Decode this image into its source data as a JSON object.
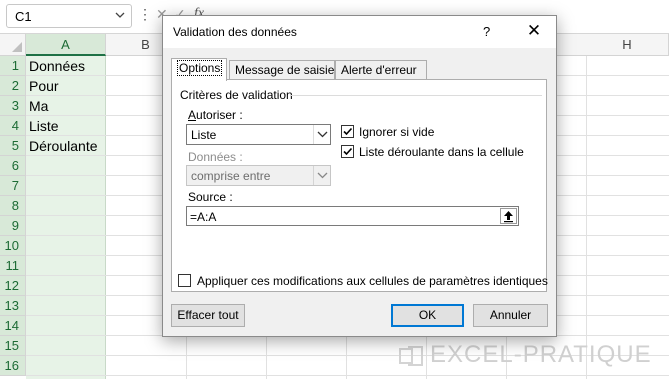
{
  "formula_bar": {
    "name_box": "C1",
    "dots": "⋮",
    "cancel_glyph": "✕",
    "enter_glyph": "✓",
    "fx_glyph": "fx"
  },
  "sheet": {
    "columns": [
      "A",
      "B",
      "H"
    ],
    "rows": [
      "1",
      "2",
      "3",
      "4",
      "5",
      "6",
      "7",
      "8",
      "9",
      "10",
      "11",
      "12",
      "13",
      "14",
      "15",
      "16"
    ],
    "cells_col_a": [
      "Données",
      "Pour",
      "Ma",
      "Liste",
      "Déroulante"
    ]
  },
  "dialog": {
    "title": "Validation des données",
    "help": "?",
    "close": "✕",
    "tabs": [
      "Options",
      "Message de saisie",
      "Alerte d'erreur"
    ],
    "group_label": "Critères de validation",
    "allow_label": "Autoriser :",
    "allow_value": "Liste",
    "data_label": "Données :",
    "data_value": "comprise entre",
    "ignore_blank": "Ignorer si vide",
    "in_cell_dropdown": "Liste déroulante dans la cellule",
    "source_label": "Source :",
    "source_value": "=A:A",
    "apply_all": "Appliquer ces modifications aux cellules de paramètres identiques",
    "clear_all": "Effacer tout",
    "ok": "OK",
    "cancel": "Annuler",
    "ignore_blank_checked": true,
    "in_cell_dropdown_checked": true,
    "apply_all_checked": false
  },
  "watermark": "EXCEL-PRATIQUE",
  "colors": {
    "selection_green": "#1e7145",
    "column_fill": "#e7f3e7",
    "accent_blue": "#0078d4"
  }
}
